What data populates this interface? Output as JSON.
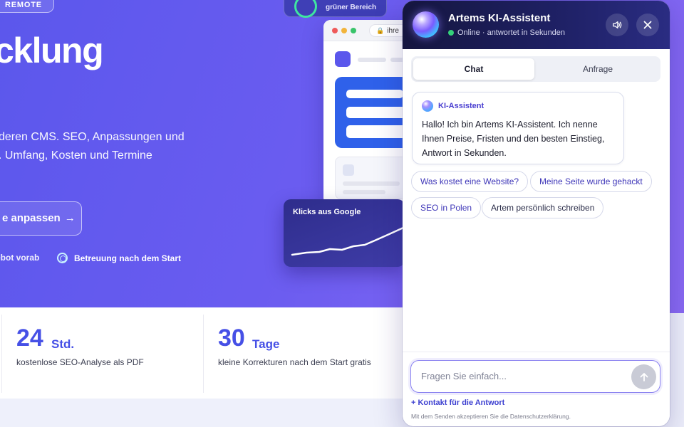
{
  "hero": {
    "badge": "REMOTE",
    "title": "cklung",
    "desc_line1": "deren CMS. SEO, Anpassungen und",
    "desc_line2": ". Umfang, Kosten und Termine",
    "cta_label": "e anpassen",
    "cta_arrow": "→",
    "feature_1": "ebot vorab",
    "feature_2": "Betreuung nach dem Start"
  },
  "mini_card": {
    "label": "grüner Bereich"
  },
  "browser_mock": {
    "url": "ihre"
  },
  "klicks_card": {
    "label": "Klicks aus Google"
  },
  "stats": [
    {
      "num": "24",
      "unit": "Std.",
      "desc": "kostenlose SEO-Analyse als PDF"
    },
    {
      "num": "30",
      "unit": "Tage",
      "desc": "kleine Korrekturen nach dem Start gratis"
    }
  ],
  "chat": {
    "title": "Artems KI-Assistent",
    "status": "Online · antwortet in Sekunden",
    "tabs": [
      {
        "label": "Chat",
        "active": true
      },
      {
        "label": "Anfrage",
        "active": false
      }
    ],
    "message": {
      "sender": "KI-Assistent",
      "text": "Hallo! Ich bin Artems KI-Assistent. Ich nenne Ihnen Preise, Fristen und den besten Einstieg, Antwort in Sekunden."
    },
    "suggestions": [
      "Was kostet eine Website?",
      "Meine Seite wurde gehackt",
      "SEO in Polen",
      "Artem persönlich schreiben"
    ],
    "input_placeholder": "Fragen Sie einfach...",
    "contact_link": "+ Kontakt für die Antwort",
    "privacy_note": "Mit dem Senden akzeptieren Sie die Datenschutzerklärung."
  },
  "colors": {
    "hero_gradient_start": "#5b57ec",
    "accent": "#4650e6",
    "chat_header": "#1f2166",
    "online": "#34d17a"
  },
  "icons": {
    "volume": "speaker-icon",
    "close": "close-icon",
    "send": "arrow-up-icon",
    "support": "lifebuoy-icon"
  }
}
